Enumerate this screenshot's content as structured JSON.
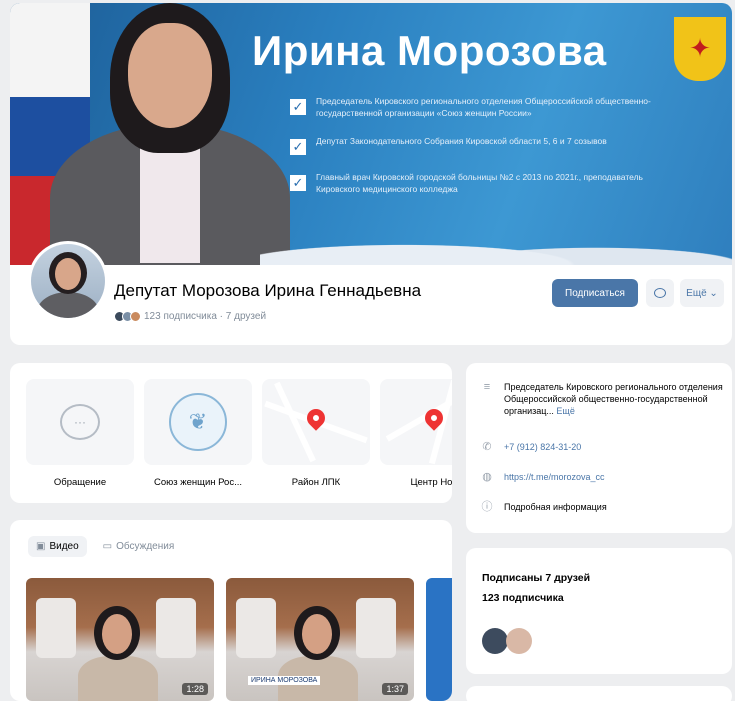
{
  "cover": {
    "title": "Ирина Морозова",
    "bullets": [
      "Председатель Кировского регионального отделения Общероссийской общественно-государственной организации «Союз женщин России»",
      "Депутат Законодательного Собрания Кировской области 5, 6 и 7 созывов",
      "Главный врач Кировской городской больницы №2 с 2013 по 2021г., преподаватель Кировского медицинского колледжа"
    ]
  },
  "profile": {
    "name": "Депутат Морозова Ирина Геннадьевна",
    "meta": "123 подписчика · 7 друзей",
    "subscribe_label": "Подписаться",
    "more_label": "Ещё",
    "colors": {
      "accent": "#4a76a8"
    }
  },
  "links": [
    {
      "label": "Обращение",
      "icon": "chat-icon"
    },
    {
      "label": "Союз женщин Рос...",
      "icon": "seal-icon"
    },
    {
      "label": "Район ЛПК",
      "icon": "map-pin-icon"
    },
    {
      "label": "Центр Нов",
      "icon": "map-pin-icon"
    }
  ],
  "video": {
    "tabs": [
      {
        "label": "Видео",
        "icon": "video-icon"
      },
      {
        "label": "Обсуждения",
        "icon": "comment-icon"
      }
    ],
    "items": [
      {
        "duration": "1:28"
      },
      {
        "duration": "1:37",
        "tag": "ИРИНА МОРОЗОВА"
      }
    ]
  },
  "info": {
    "description": "Председатель Кировского регионального отделения Общероссийской общественно-государственной организац...",
    "description_more": "Ещё",
    "phone": "+7 (912) 824-31-20",
    "link": "https://t.me/morozova_cc",
    "details": "Подробная информация"
  },
  "friends": {
    "title": "Подписаны 7 друзей",
    "subscribers": "123 подписчика"
  }
}
